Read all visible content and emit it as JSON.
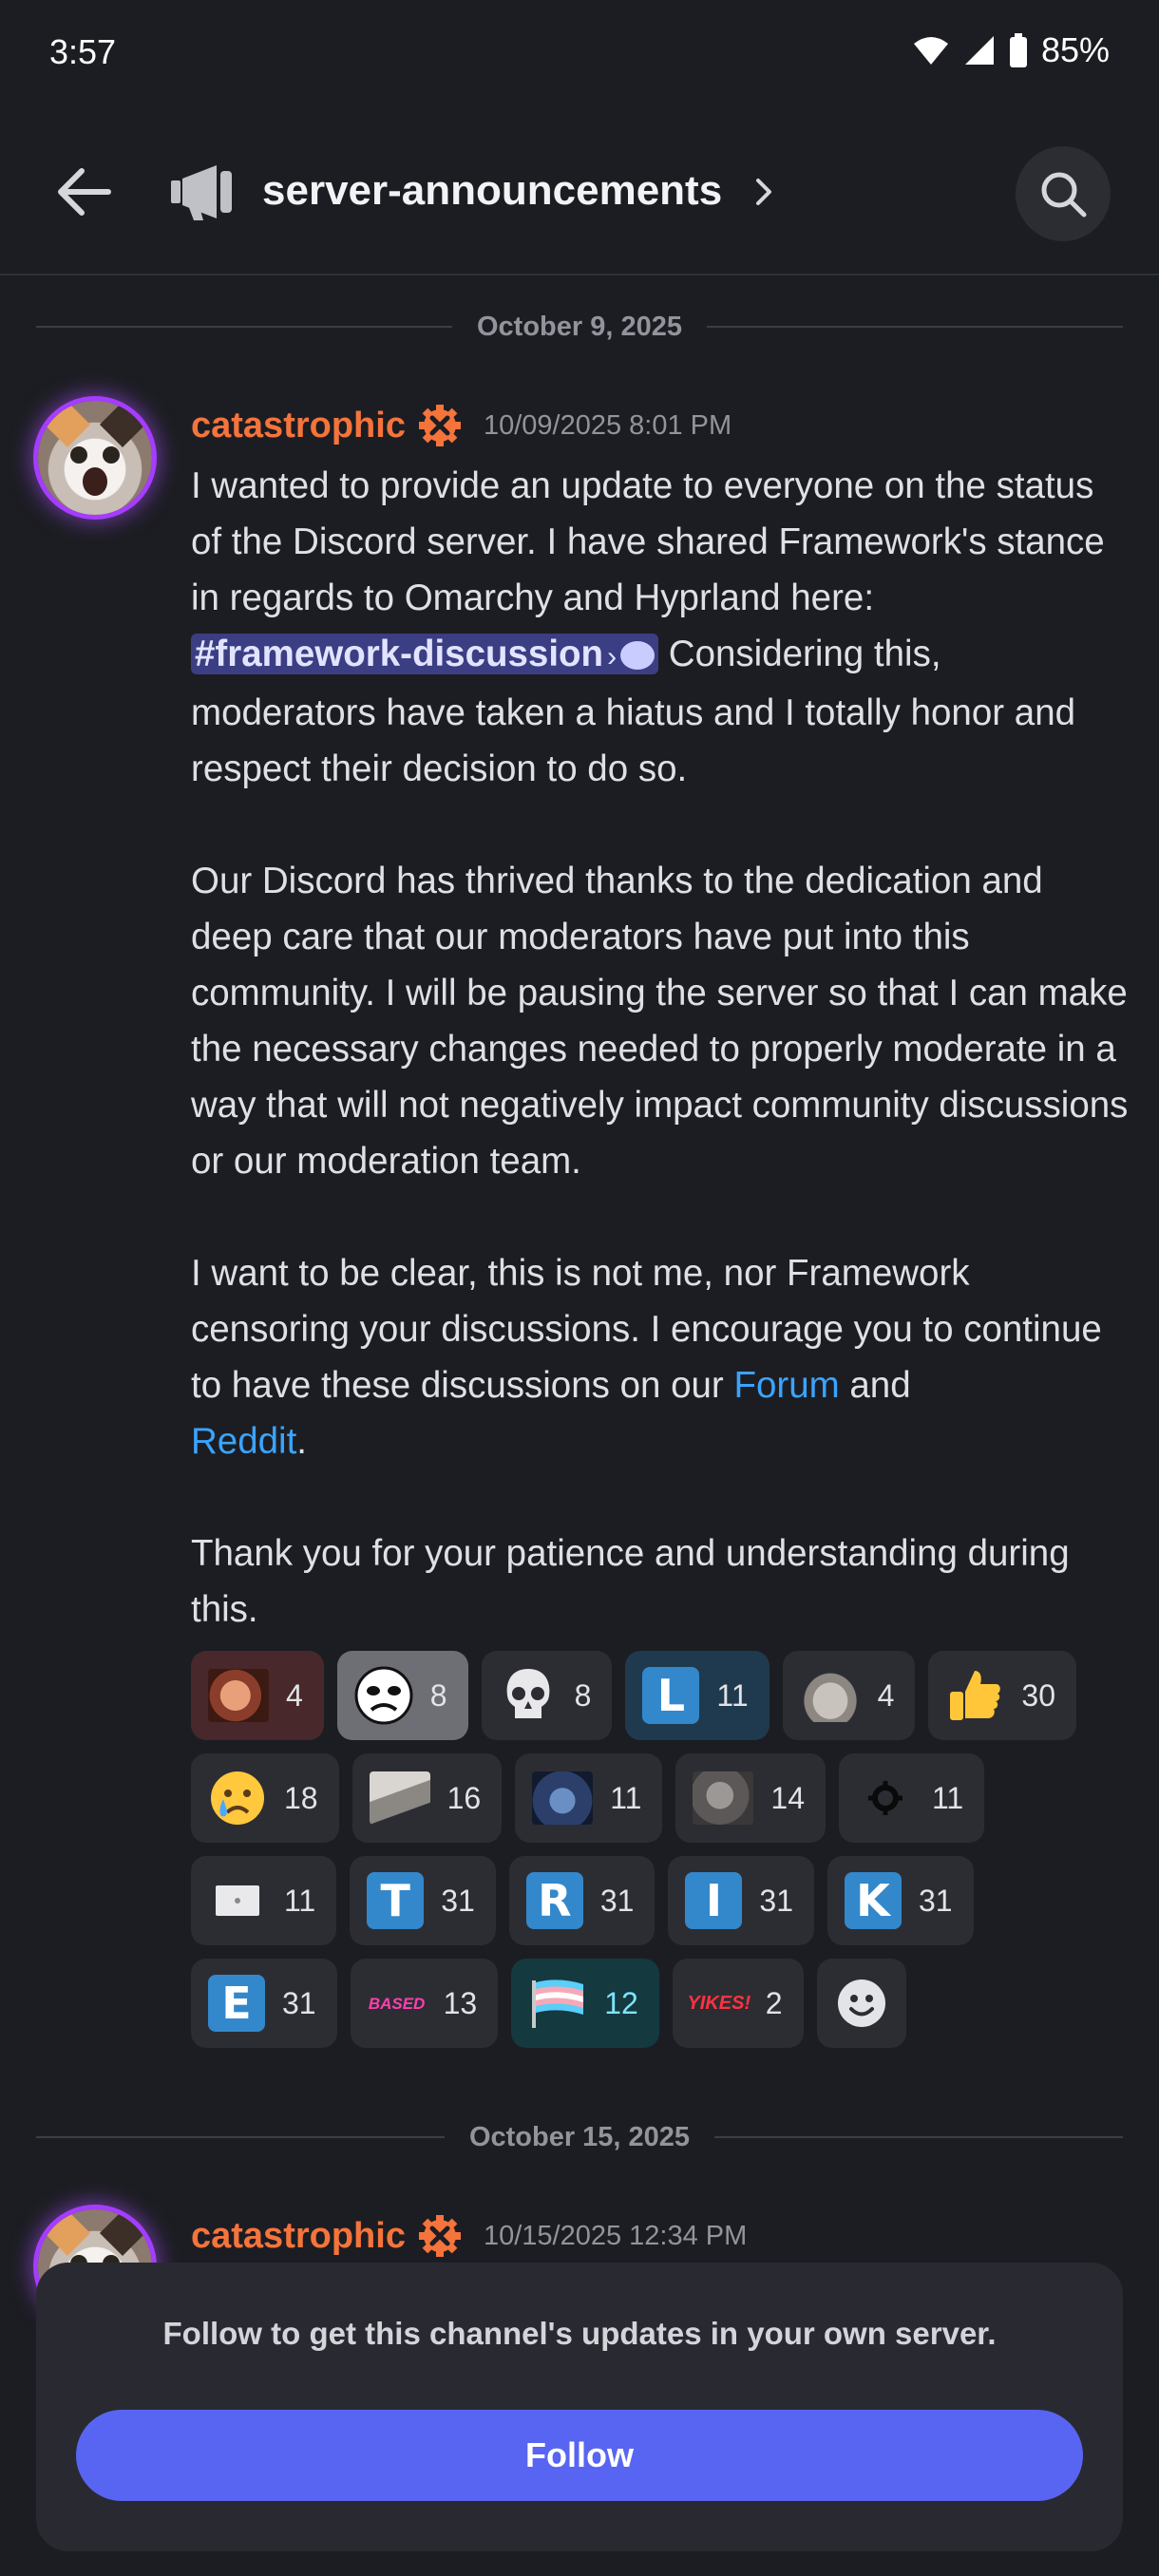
{
  "status_bar": {
    "time": "3:57",
    "battery": "85%"
  },
  "header": {
    "channel_name": "server-announcements"
  },
  "dividers": [
    "October 9, 2025",
    "October 15, 2025"
  ],
  "message1": {
    "author": "catastrophic",
    "timestamp": "10/09/2025 8:01 PM",
    "p1_a": "I wanted to provide an update to everyone on the status of the Discord server. I have shared Framework's stance in regards to Omarchy and Hyprland here: ",
    "mention": "#framework-discussion",
    "p1_b": " Considering this, moderators have taken a hiatus and I totally honor and respect their decision to do so.",
    "p2": "Our Discord has thrived thanks to the dedication and deep care that our moderators have put into this community. I will be pausing the server so that I can make the necessary changes needed to properly moderate in a way that will not negatively impact community discussions or our moderation team.",
    "p3_a": "I want to be clear, this is not me, nor Framework censoring your discussions. I encourage you to continue to have these discussions on our ",
    "link_forum": "Forum",
    "p3_b": " and ",
    "link_reddit": "Reddit",
    "p3_c": ".",
    "p4": "Thank you for your patience and understanding during this."
  },
  "reactions": [
    {
      "emoji": "laughing-face-pic",
      "count": "4"
    },
    {
      "emoji": "troll-face",
      "count": "8"
    },
    {
      "emoji": "skull",
      "count": "8"
    },
    {
      "emoji": "letter-L",
      "letter": "L",
      "count": "11"
    },
    {
      "emoji": "hamster-pic",
      "count": "4"
    },
    {
      "emoji": "thumbs-up",
      "count": "30"
    },
    {
      "emoji": "crying-face",
      "count": "18"
    },
    {
      "emoji": "laptop-pic",
      "count": "16"
    },
    {
      "emoji": "sad-face-pic",
      "count": "11"
    },
    {
      "emoji": "cat-pic",
      "count": "14"
    },
    {
      "emoji": "gear-logo",
      "count": "11"
    },
    {
      "emoji": "card-pic",
      "count": "11"
    },
    {
      "emoji": "letter-T",
      "letter": "T",
      "count": "31"
    },
    {
      "emoji": "letter-R",
      "letter": "R",
      "count": "31"
    },
    {
      "emoji": "letter-I",
      "letter": "I",
      "count": "31"
    },
    {
      "emoji": "letter-K",
      "letter": "K",
      "count": "31"
    },
    {
      "emoji": "letter-E",
      "letter": "E",
      "count": "31"
    },
    {
      "emoji": "based-text",
      "text": "BASED",
      "count": "13"
    },
    {
      "emoji": "trans-flag",
      "count": "12"
    },
    {
      "emoji": "yikes-text",
      "text": "YIKES!",
      "count": "2"
    }
  ],
  "message2": {
    "author": "catastrophic",
    "timestamp": "10/15/2025 12:34 PM"
  },
  "follow_panel": {
    "text": "Follow to get this channel's updates in your own server.",
    "button": "Follow"
  },
  "colors": {
    "accent": "#5865f2",
    "author": "#f5743c",
    "link": "#3aa4ff",
    "background": "#1c1d22"
  }
}
